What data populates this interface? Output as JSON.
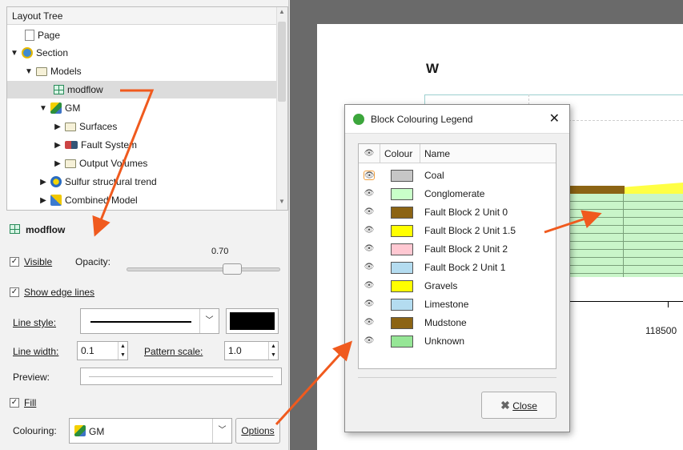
{
  "tree": {
    "title": "Layout Tree",
    "items": [
      {
        "label": "Page"
      },
      {
        "label": "Section"
      },
      {
        "label": "Models"
      },
      {
        "label": "modflow"
      },
      {
        "label": "GM"
      },
      {
        "label": "Surfaces"
      },
      {
        "label": "Fault System"
      },
      {
        "label": "Output Volumes"
      },
      {
        "label": "Sulfur structural trend"
      },
      {
        "label": "Combined Model"
      }
    ]
  },
  "props": {
    "title": "modflow",
    "visible_label": "Visible",
    "opacity_label": "Opacity:",
    "opacity_value": "0.70",
    "opacity_fraction": 0.7,
    "show_edge_lines_label": "Show edge lines",
    "line_style_label": "Line style:",
    "line_colour": "#000000",
    "line_width_label": "Line width:",
    "line_width_value": "0.1",
    "pattern_scale_label": "Pattern scale:",
    "pattern_scale_value": "1.0",
    "preview_label": "Preview:",
    "fill_label": "Fill",
    "colouring_label": "Colouring:",
    "colouring_value": "GM",
    "options_label": "Options"
  },
  "section": {
    "w_label": "W",
    "axis_tick": "118500"
  },
  "dialog": {
    "title": "Block Colouring Legend",
    "col_colour": "Colour",
    "col_name": "Name",
    "rows": [
      {
        "name": "Coal",
        "color": "#c6c6c6"
      },
      {
        "name": "Conglomerate",
        "color": "#c9ffc9"
      },
      {
        "name": "Fault Block 2 Unit 0",
        "color": "#8c6414"
      },
      {
        "name": "Fault Block 2 Unit 1.5",
        "color": "#ffff00"
      },
      {
        "name": "Fault Block 2 Unit 2",
        "color": "#ffc8d2"
      },
      {
        "name": "Fault Bock 2 Unit 1",
        "color": "#b4dcf0"
      },
      {
        "name": "Gravels",
        "color": "#ffff00"
      },
      {
        "name": "Limestone",
        "color": "#b4dcf0"
      },
      {
        "name": "Mudstone",
        "color": "#8c6414"
      },
      {
        "name": "Unknown",
        "color": "#96e696"
      }
    ],
    "close_label": "Close"
  },
  "colors": {
    "annotation_arrow": "#f05a1e",
    "model_fill": "#c9f5c9",
    "mudstone": "#8c6414",
    "gravels": "#ffff00"
  }
}
